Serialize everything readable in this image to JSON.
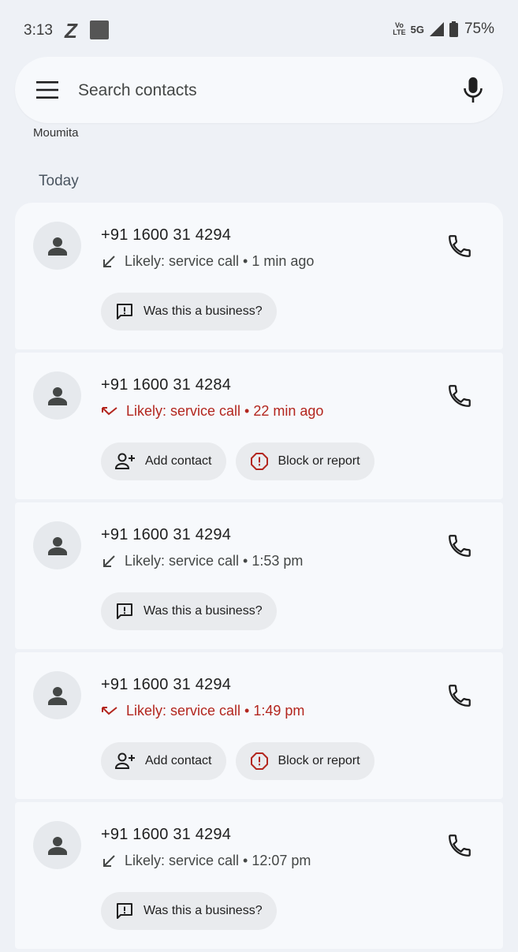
{
  "status_bar": {
    "time": "3:13",
    "z_icon": "Z",
    "volte_top": "Vo",
    "volte_bottom": "LTE",
    "network": "5G",
    "battery": "75%"
  },
  "search": {
    "placeholder": "Search contacts"
  },
  "partial_contact": "Moumita",
  "section": "Today",
  "calls": [
    {
      "number": "+91 1600 31 4294",
      "direction": "incoming",
      "detail": "Likely: service call • 1 min ago",
      "chips": [
        {
          "label": "Was this a business?",
          "icon": "feedback-icon"
        }
      ]
    },
    {
      "number": "+91 1600 31 4284",
      "direction": "missed",
      "detail": "Likely: service call • 22 min ago",
      "chips": [
        {
          "label": "Add contact",
          "icon": "add-person-icon"
        },
        {
          "label": "Block or report",
          "icon": "block-report-icon"
        }
      ]
    },
    {
      "number": "+91 1600 31 4294",
      "direction": "incoming",
      "detail": "Likely: service call • 1:53 pm",
      "chips": [
        {
          "label": "Was this a business?",
          "icon": "feedback-icon"
        }
      ]
    },
    {
      "number": "+91 1600 31 4294",
      "direction": "missed",
      "detail": "Likely: service call • 1:49 pm",
      "chips": [
        {
          "label": "Add contact",
          "icon": "add-person-icon"
        },
        {
          "label": "Block or report",
          "icon": "block-report-icon"
        }
      ]
    },
    {
      "number": "+91 1600 31 4294",
      "direction": "incoming",
      "detail": "Likely: service call • 12:07 pm",
      "chips": [
        {
          "label": "Was this a business?",
          "icon": "feedback-icon"
        }
      ]
    }
  ],
  "colors": {
    "background": "#eef1f6",
    "card": "#f7f9fc",
    "missed": "#b3261e",
    "chip": "#e9ebee"
  }
}
